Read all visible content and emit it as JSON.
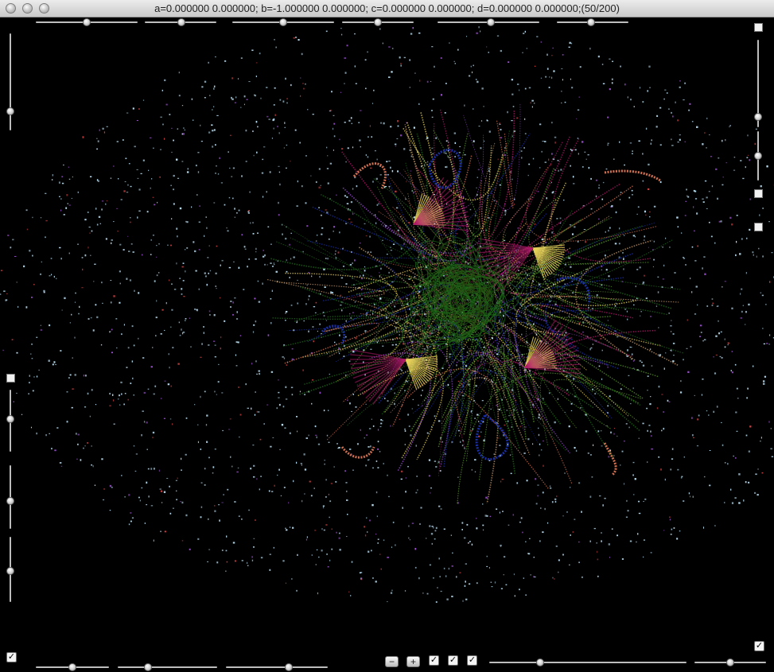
{
  "window": {
    "title": "a=0.000000 0.000000; b=-1.000000 0.000000; c=0.000000 0.000000; d=0.000000 0.000000;(50/200)"
  },
  "visualization": {
    "description_colors": [
      "#b8dcf0",
      "#9b4fd0",
      "#b01a6a",
      "#e8d35a",
      "#5a9a2a",
      "#1e6a1a",
      "#1a2fa0",
      "#d07050",
      "#c79a6a"
    ]
  },
  "controls": {
    "zoom_out_label": "−",
    "zoom_in_label": "+",
    "checkbox_mark": "✓"
  },
  "colors": {
    "background": "#000000",
    "titlebar": "#d8d8d8"
  }
}
